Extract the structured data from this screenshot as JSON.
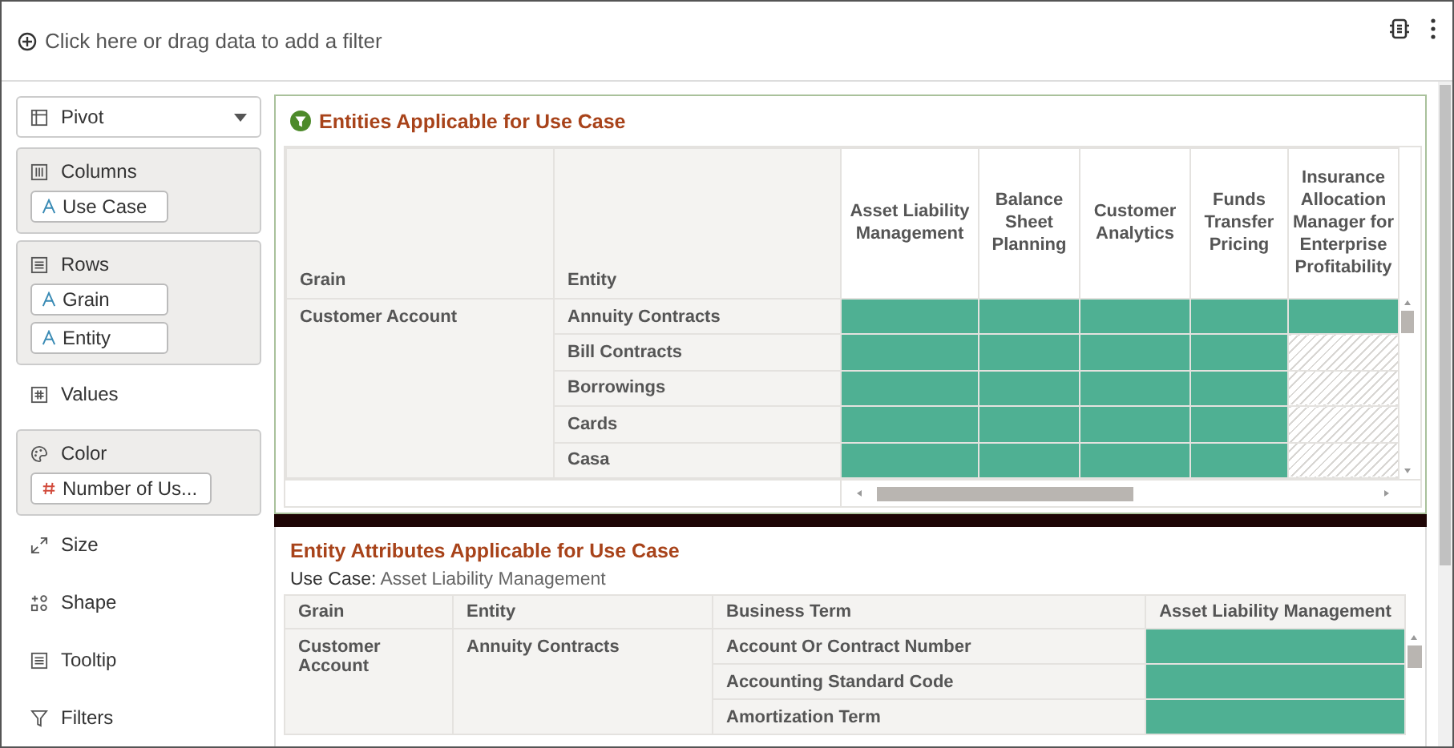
{
  "filter_bar": {
    "prompt": "Click here or drag data to add a filter"
  },
  "sidebar": {
    "view_selector": {
      "label": "Pivot"
    },
    "sections": [
      {
        "label": "Columns",
        "boxed": true,
        "fields": [
          {
            "label": "Use Case",
            "kind": "text"
          }
        ]
      },
      {
        "label": "Rows",
        "boxed": true,
        "fields": [
          {
            "label": "Grain",
            "kind": "text"
          },
          {
            "label": "Entity",
            "kind": "text"
          }
        ]
      },
      {
        "label": "Values",
        "boxed": false
      },
      {
        "label": "Color",
        "boxed": true,
        "fields": [
          {
            "label": "Number of Us...",
            "kind": "number"
          }
        ]
      },
      {
        "label": "Size",
        "boxed": false
      },
      {
        "label": "Shape",
        "boxed": false
      },
      {
        "label": "Tooltip",
        "boxed": false
      },
      {
        "label": "Filters",
        "boxed": false
      }
    ]
  },
  "pivot": {
    "title": "Entities Applicable for Use Case",
    "row_headers": [
      "Grain",
      "Entity"
    ],
    "columns": [
      "Asset Liability Management",
      "Balance Sheet Planning",
      "Customer Analytics",
      "Funds Transfer Pricing",
      "Insurance Allocation Manager for Enterprise Profitability"
    ],
    "grain": "Customer Account",
    "rows": [
      {
        "entity": "Annuity Contracts",
        "cells": [
          {
            "applicable": true
          },
          {
            "applicable": true
          },
          {
            "applicable": true
          },
          {
            "applicable": true
          },
          {
            "applicable": true
          }
        ]
      },
      {
        "entity": "Bill Contracts",
        "cells": [
          {
            "applicable": true
          },
          {
            "applicable": true
          },
          {
            "applicable": true
          },
          {
            "applicable": true
          },
          {
            "applicable": false
          }
        ]
      },
      {
        "entity": "Borrowings",
        "cells": [
          {
            "applicable": true
          },
          {
            "applicable": true
          },
          {
            "applicable": true
          },
          {
            "applicable": true
          },
          {
            "applicable": false
          }
        ]
      },
      {
        "entity": "Cards",
        "cells": [
          {
            "applicable": true
          },
          {
            "applicable": true
          },
          {
            "applicable": true
          },
          {
            "applicable": true
          },
          {
            "applicable": false
          }
        ]
      },
      {
        "entity": "Casa",
        "cells": [
          {
            "applicable": true
          },
          {
            "applicable": true
          },
          {
            "applicable": true
          },
          {
            "applicable": true
          },
          {
            "applicable": false
          }
        ]
      }
    ]
  },
  "attributes": {
    "title": "Entity Attributes Applicable for Use Case",
    "use_case_label": "Use Case:",
    "use_case_value": "Asset Liability Management",
    "columns": [
      "Grain",
      "Entity",
      "Business Term",
      "Asset Liability Management"
    ],
    "grain": "Customer Account",
    "entity": "Annuity Contracts",
    "rows": [
      {
        "term": "Account Or Contract Number",
        "applicable": true
      },
      {
        "term": "Accounting Standard Code",
        "applicable": true
      },
      {
        "term": "Amortization Term",
        "applicable": true
      }
    ]
  }
}
